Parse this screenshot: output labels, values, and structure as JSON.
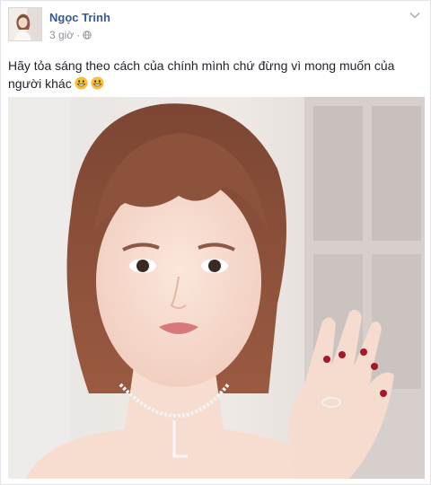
{
  "post": {
    "author": "Ngọc Trinh",
    "time": "3 giờ",
    "separator": "·",
    "privacy_icon": "globe-icon",
    "menu_icon": "chevron-down-icon",
    "text": "Hãy tỏa sáng theo cách của chính mình chứ đừng vì mong muốn của người khác",
    "emojis": [
      "grinning-face-icon",
      "grinning-face-icon"
    ],
    "photo_alt": "Ngọc Trinh"
  },
  "colors": {
    "author_link": "#365899",
    "meta_text": "#90949c",
    "body_text": "#1d2129"
  }
}
